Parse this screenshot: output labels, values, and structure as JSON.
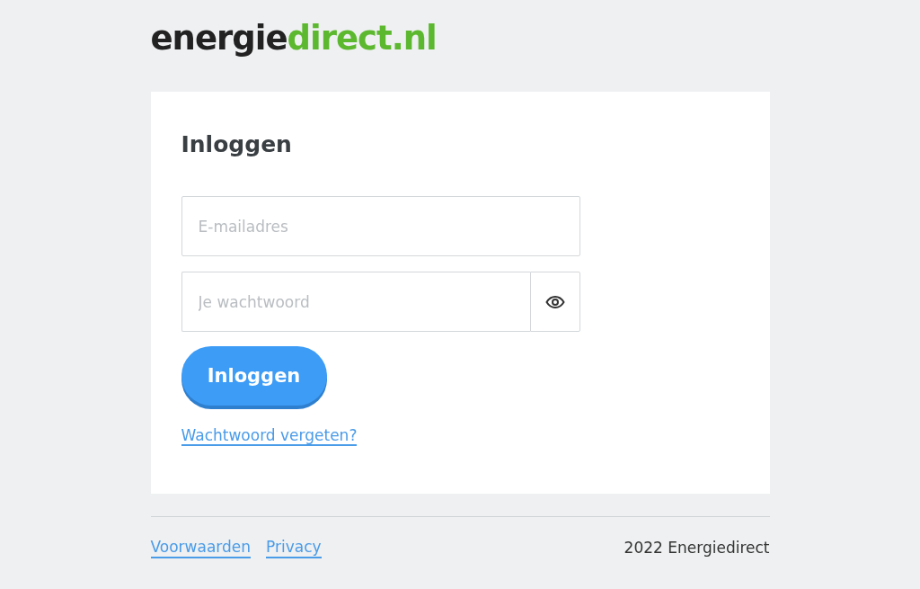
{
  "logo": [
    {
      "text": "energie",
      "color": "#222222"
    },
    {
      "text": "direct.nl",
      "color": "#5cb82e"
    }
  ],
  "login": {
    "title": "Inloggen",
    "email": {
      "placeholder": "E-mailadres"
    },
    "password": {
      "placeholder": "Je wachtwoord"
    },
    "submit": "Inloggen",
    "forgot_link": "Wachtwoord vergeten?"
  },
  "footer": {
    "links": [
      "Voorwaarden",
      "Privacy"
    ],
    "copyright": "2022 Energiedirect"
  }
}
